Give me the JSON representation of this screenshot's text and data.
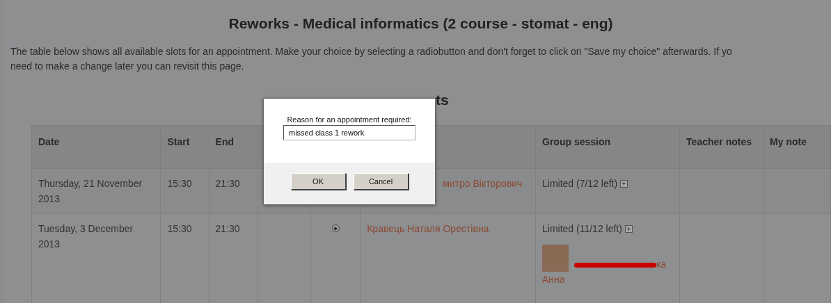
{
  "title": "Reworks - Medical informatics (2 course - stomat - eng)",
  "intro_lines": [
    "The table below shows all available slots for an appointment. Make your choice by selecting a radiobutton and don't forget to click on \"Save my choice\" afterwards. If yo",
    "need to make a change later you can revisit this page."
  ],
  "slots_heading": "ts",
  "table": {
    "columns": [
      "Date",
      "Start",
      "End",
      "",
      "",
      "",
      "Group session",
      "Teacher notes",
      "My note"
    ],
    "rows": [
      {
        "date": "Thursday, 21 November 2013",
        "start": "15:30",
        "end": "21:30",
        "teacher": "митро Вікторович",
        "group_session": "Limited (7/12 left)",
        "participants": []
      },
      {
        "date": "Tuesday, 3 December 2013",
        "start": "15:30",
        "end": "21:30",
        "radio": {
          "selected": true
        },
        "teacher": "Кравець Наталя Орестівна",
        "group_session": "Limited (11/12 left)",
        "participants": [
          {
            "name_tail": "ка",
            "given_name": "Анна",
            "redacted": true
          }
        ]
      }
    ]
  },
  "dialog": {
    "label": "Reason for an appointment required:",
    "value": "missed class 1 rework",
    "buttons": [
      "OK",
      "Cancel"
    ]
  }
}
